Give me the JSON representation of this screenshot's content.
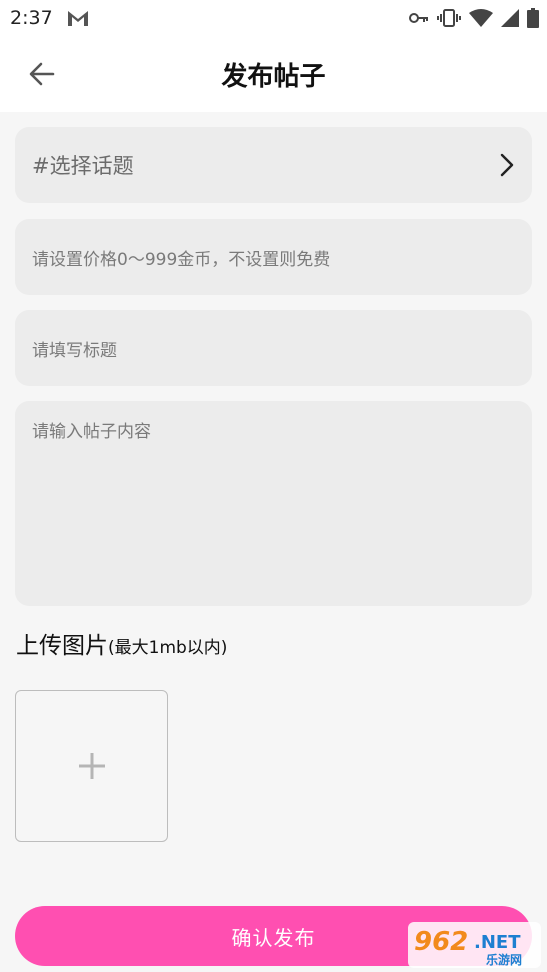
{
  "status_bar": {
    "time": "2:37",
    "icons": [
      "gmail-icon",
      "key-icon",
      "vibrate-icon",
      "wifi-icon",
      "signal-icon",
      "battery-icon"
    ]
  },
  "header": {
    "title": "发布帖子",
    "back_icon": "arrow-left-icon"
  },
  "form": {
    "topic_placeholder": "#选择话题",
    "price_placeholder": "请设置价格0～999金币，不设置则免费",
    "title_placeholder": "请填写标题",
    "content_placeholder": "请输入帖子内容"
  },
  "upload": {
    "label": "上传图片",
    "hint": "(最大1mb以内)",
    "add_icon": "plus-icon"
  },
  "submit": {
    "label": "确认发布"
  },
  "watermark": {
    "brand": "962",
    "brand_suffix": ".NET",
    "caption": "乐游网"
  },
  "colors": {
    "accent": "#ff4fb1",
    "field_bg": "#ececec",
    "page_bg": "#f6f6f6",
    "placeholder": "#7a7a7a"
  }
}
